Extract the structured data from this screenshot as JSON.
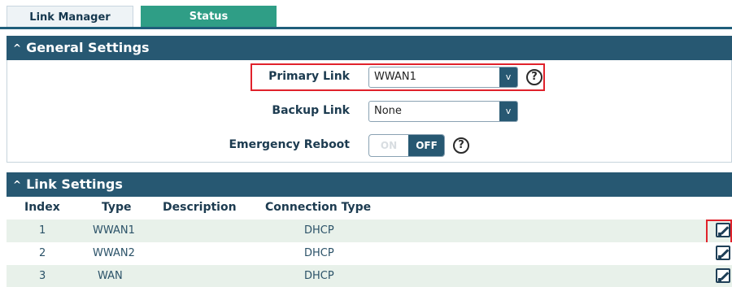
{
  "tabs": {
    "link_manager": "Link Manager",
    "status": "Status"
  },
  "general": {
    "title": "General Settings",
    "primary_link_label": "Primary Link",
    "primary_link_value": "WWAN1",
    "backup_link_label": "Backup Link",
    "backup_link_value": "None",
    "emergency_reboot_label": "Emergency Reboot",
    "toggle_on": "ON",
    "toggle_off": "OFF",
    "help_glyph": "?",
    "select_arrow": "v"
  },
  "link_settings": {
    "title": "Link Settings",
    "columns": {
      "index": "Index",
      "type": "Type",
      "description": "Description",
      "connection_type": "Connection Type"
    },
    "rows": [
      {
        "index": "1",
        "type": "WWAN1",
        "description": "",
        "connection_type": "DHCP"
      },
      {
        "index": "2",
        "type": "WWAN2",
        "description": "",
        "connection_type": "DHCP"
      },
      {
        "index": "3",
        "type": "WAN",
        "description": "",
        "connection_type": "DHCP"
      }
    ]
  },
  "colors": {
    "header_bg": "#275872",
    "status_tab_bg": "#2f9e86",
    "highlight": "#e0222b",
    "row_alt": "#e8f1ea"
  },
  "icons": {
    "section_toggle": "chevron-up-icon",
    "help": "question-circle-icon",
    "edit": "edit-icon"
  }
}
